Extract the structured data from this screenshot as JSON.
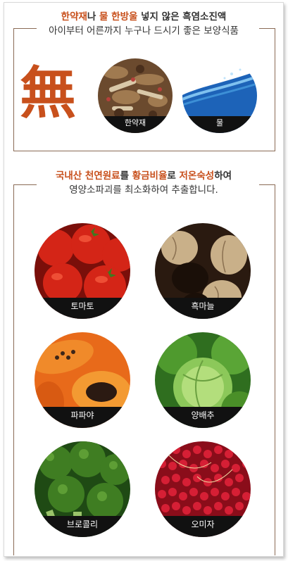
{
  "section1": {
    "line1": [
      {
        "text": "한약재",
        "accent": true
      },
      {
        "text": "나 ",
        "accent": false
      },
      {
        "text": "물 한방울",
        "accent": true
      },
      {
        "text": " 넣지 않은 흑염소진액",
        "accent": false
      }
    ],
    "line2": "아이부터 어른까지 누구나 드시기 좋은 보양식품",
    "symbol": "無",
    "items": [
      {
        "label": "한약재",
        "icon": "herbs-photo"
      },
      {
        "label": "물",
        "icon": "water-photo"
      }
    ]
  },
  "section2": {
    "line1": [
      {
        "text": "국내산 천연원료",
        "accent": true
      },
      {
        "text": "를 ",
        "accent": false
      },
      {
        "text": "황금비율",
        "accent": true
      },
      {
        "text": "로 ",
        "accent": false
      },
      {
        "text": "저온숙성",
        "accent": true
      },
      {
        "text": "하여",
        "accent": false
      }
    ],
    "line2": "영양소파괴를 최소화하여 추출합니다.",
    "items": [
      {
        "label": "토마토",
        "icon": "tomato-photo"
      },
      {
        "label": "흑마늘",
        "icon": "black-garlic-photo"
      },
      {
        "label": "파파야",
        "icon": "papaya-photo"
      },
      {
        "label": "양배추",
        "icon": "cabbage-photo"
      },
      {
        "label": "브로콜리",
        "icon": "broccoli-photo"
      },
      {
        "label": "오미자",
        "icon": "omija-berry-photo"
      }
    ]
  },
  "colors": {
    "accent": "#c8501c",
    "frame": "#8a6a55",
    "caption_bg": "#111111"
  }
}
